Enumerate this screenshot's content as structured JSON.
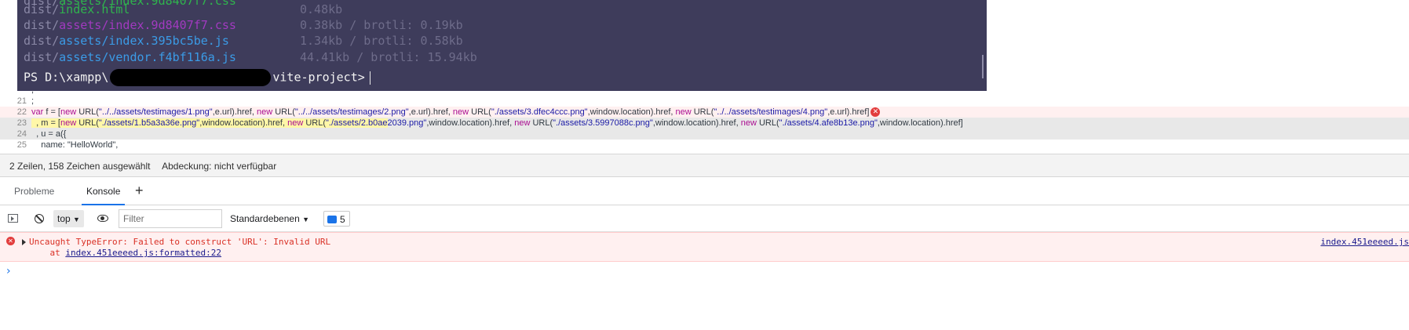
{
  "terminal": {
    "rows": [
      {
        "dir": "dist/",
        "file": "index.html",
        "file_color": "green",
        "size": "0.48kb"
      },
      {
        "dir": "dist/",
        "file": "assets/index.9d8407f7.css",
        "file_color": "purple",
        "size": "0.38kb / brotli: 0.19kb"
      },
      {
        "dir": "dist/",
        "file": "assets/index.395bc5be.js",
        "file_color": "blue",
        "size": "1.34kb / brotli: 0.58kb"
      },
      {
        "dir": "dist/",
        "file": "assets/vendor.f4bf116a.js",
        "file_color": "blue",
        "size": "44.41kb / brotli: 15.94kb"
      }
    ],
    "prompt_prefix": "PS D:\\xampp\\",
    "prompt_suffix": "vite-project>"
  },
  "code": {
    "lines": [
      {
        "num": "21",
        "text": ";"
      },
      {
        "num": "22",
        "text": "var f = [new URL(\"../../assets/testimages/1.png\",e.url).href, new URL(\"../../assets/testimages/2.png\",e.url).href, new URL(\"./assets/3.dfec4ccc.png\",window.location).href, new URL(\"../../assets/testimages/4.png\",e.url).href]"
      },
      {
        "num": "23",
        "text": "  , m = [new URL(\"./assets/1.b5a3a36e.png\",window.location).href, new URL(\"./assets/2.b0ae2039.png\",window.location).href, new URL(\"./assets/3.5997088c.png\",window.location).href, new URL(\"./assets/4.afe8b13e.png\",window.location).href]"
      },
      {
        "num": "24",
        "text": "  , u = a({"
      },
      {
        "num": "25",
        "text": "    name: \"HelloWorld\","
      }
    ]
  },
  "status": {
    "selection": "2 Zeilen, 158 Zeichen ausgewählt",
    "coverage": "Abdeckung: nicht verfügbar"
  },
  "tabs": [
    {
      "label": "Probleme",
      "active": false
    },
    {
      "label": "Konsole",
      "active": true
    }
  ],
  "toolbar": {
    "context": "top",
    "filter_placeholder": "Filter",
    "levels": "Standardebenen",
    "issues_count": "5"
  },
  "console": {
    "error_line1": "Uncaught TypeError: Failed to construct 'URL': Invalid URL",
    "error_at": "    at ",
    "error_link": "index.451eeeed.js:formatted:22",
    "source_link": "index.451eeeed.js",
    "prompt": "›"
  },
  "colors": {
    "terminal_bg": "#3e3c5b",
    "error_bg": "#fff0f0",
    "accent": "#1a73e8"
  }
}
